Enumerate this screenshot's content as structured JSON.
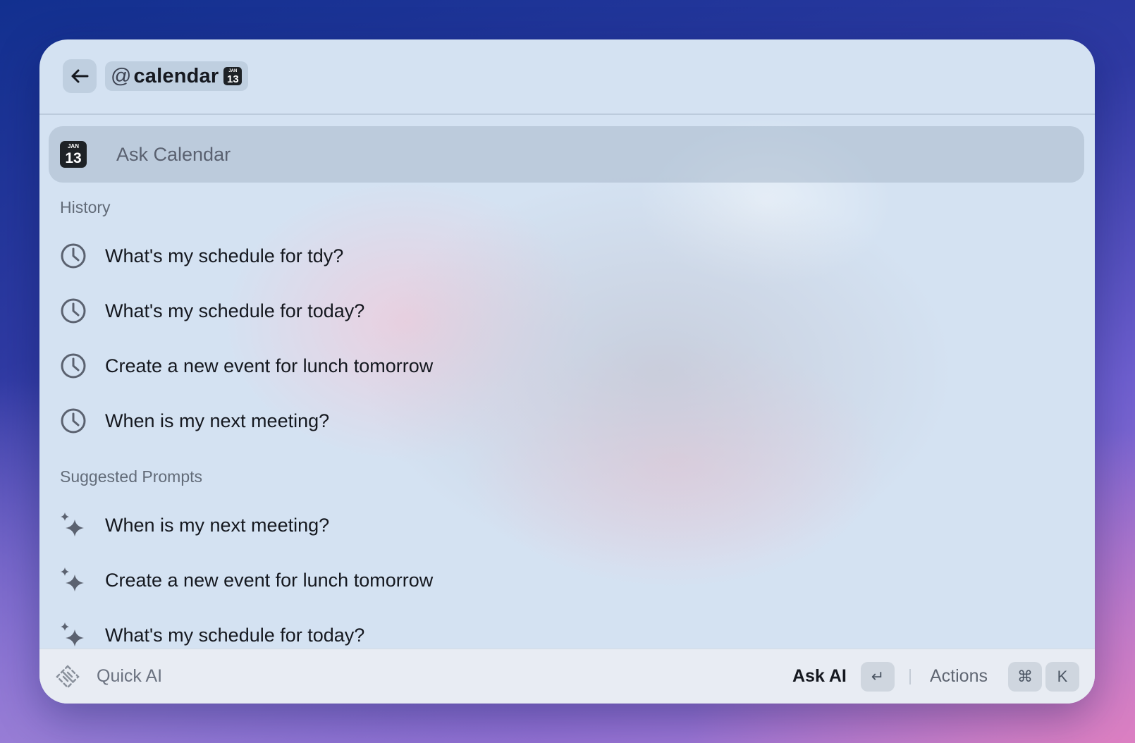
{
  "header": {
    "back_icon": "arrow-left-icon",
    "mention": {
      "at": "@",
      "name": "calendar"
    },
    "calendar_icon": {
      "month": "JAN",
      "day": "13"
    }
  },
  "ask_row": {
    "label": "Ask Calendar",
    "calendar_icon": {
      "month": "JAN",
      "day": "13"
    }
  },
  "history": {
    "title": "History",
    "icon": "clock-icon",
    "items": [
      {
        "label": "What's my schedule for tdy?"
      },
      {
        "label": "What's my schedule for today?"
      },
      {
        "label": "Create a new event for lunch tomorrow"
      },
      {
        "label": "When is my next meeting?"
      }
    ]
  },
  "suggested": {
    "title": "Suggested Prompts",
    "icon": "sparkles-icon",
    "items": [
      {
        "label": "When is my next meeting?"
      },
      {
        "label": "Create a new event for lunch tomorrow"
      },
      {
        "label": "What's my schedule for today?"
      }
    ]
  },
  "footer": {
    "app_label": "Quick AI",
    "primary_action": "Ask AI",
    "primary_key": "↵",
    "actions_label": "Actions",
    "actions_keys": [
      "⌘",
      "K"
    ]
  },
  "colors": {
    "window_bg": "#d4e2f2",
    "selected_row": "#b9c6d6",
    "icon_gray": "#5b6270",
    "text_primary": "#15181f"
  }
}
